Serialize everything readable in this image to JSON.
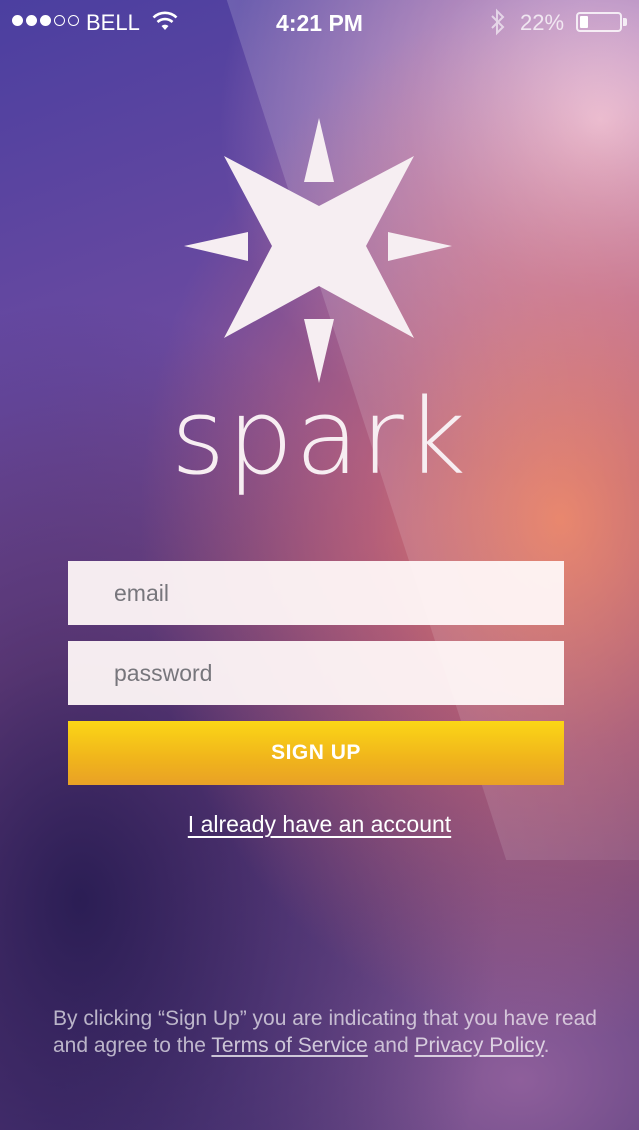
{
  "status_bar": {
    "signal_bars_filled": 3,
    "signal_bars_total": 5,
    "carrier": "BELL",
    "time": "4:21 PM",
    "battery_percent": "22%",
    "battery_level": 0.22
  },
  "brand": {
    "name": "spark"
  },
  "form": {
    "email_placeholder": "email",
    "password_placeholder": "password",
    "signup_label": "SIGN UP",
    "login_link": "I already have an account"
  },
  "legal": {
    "text_before": "By clicking “Sign Up” you are indicating that you have read and agree to the ",
    "terms_link": "Terms of Service",
    "text_middle": " and ",
    "privacy_link": "Privacy Policy",
    "text_after": "."
  },
  "colors": {
    "signup_button": "#f4c21c",
    "field_background": "#fbf3f4",
    "text_light": "#ffffff"
  },
  "icons": [
    "signal-icon",
    "wifi-icon",
    "bluetooth-icon",
    "battery-icon",
    "spark-star-logo-icon"
  ]
}
